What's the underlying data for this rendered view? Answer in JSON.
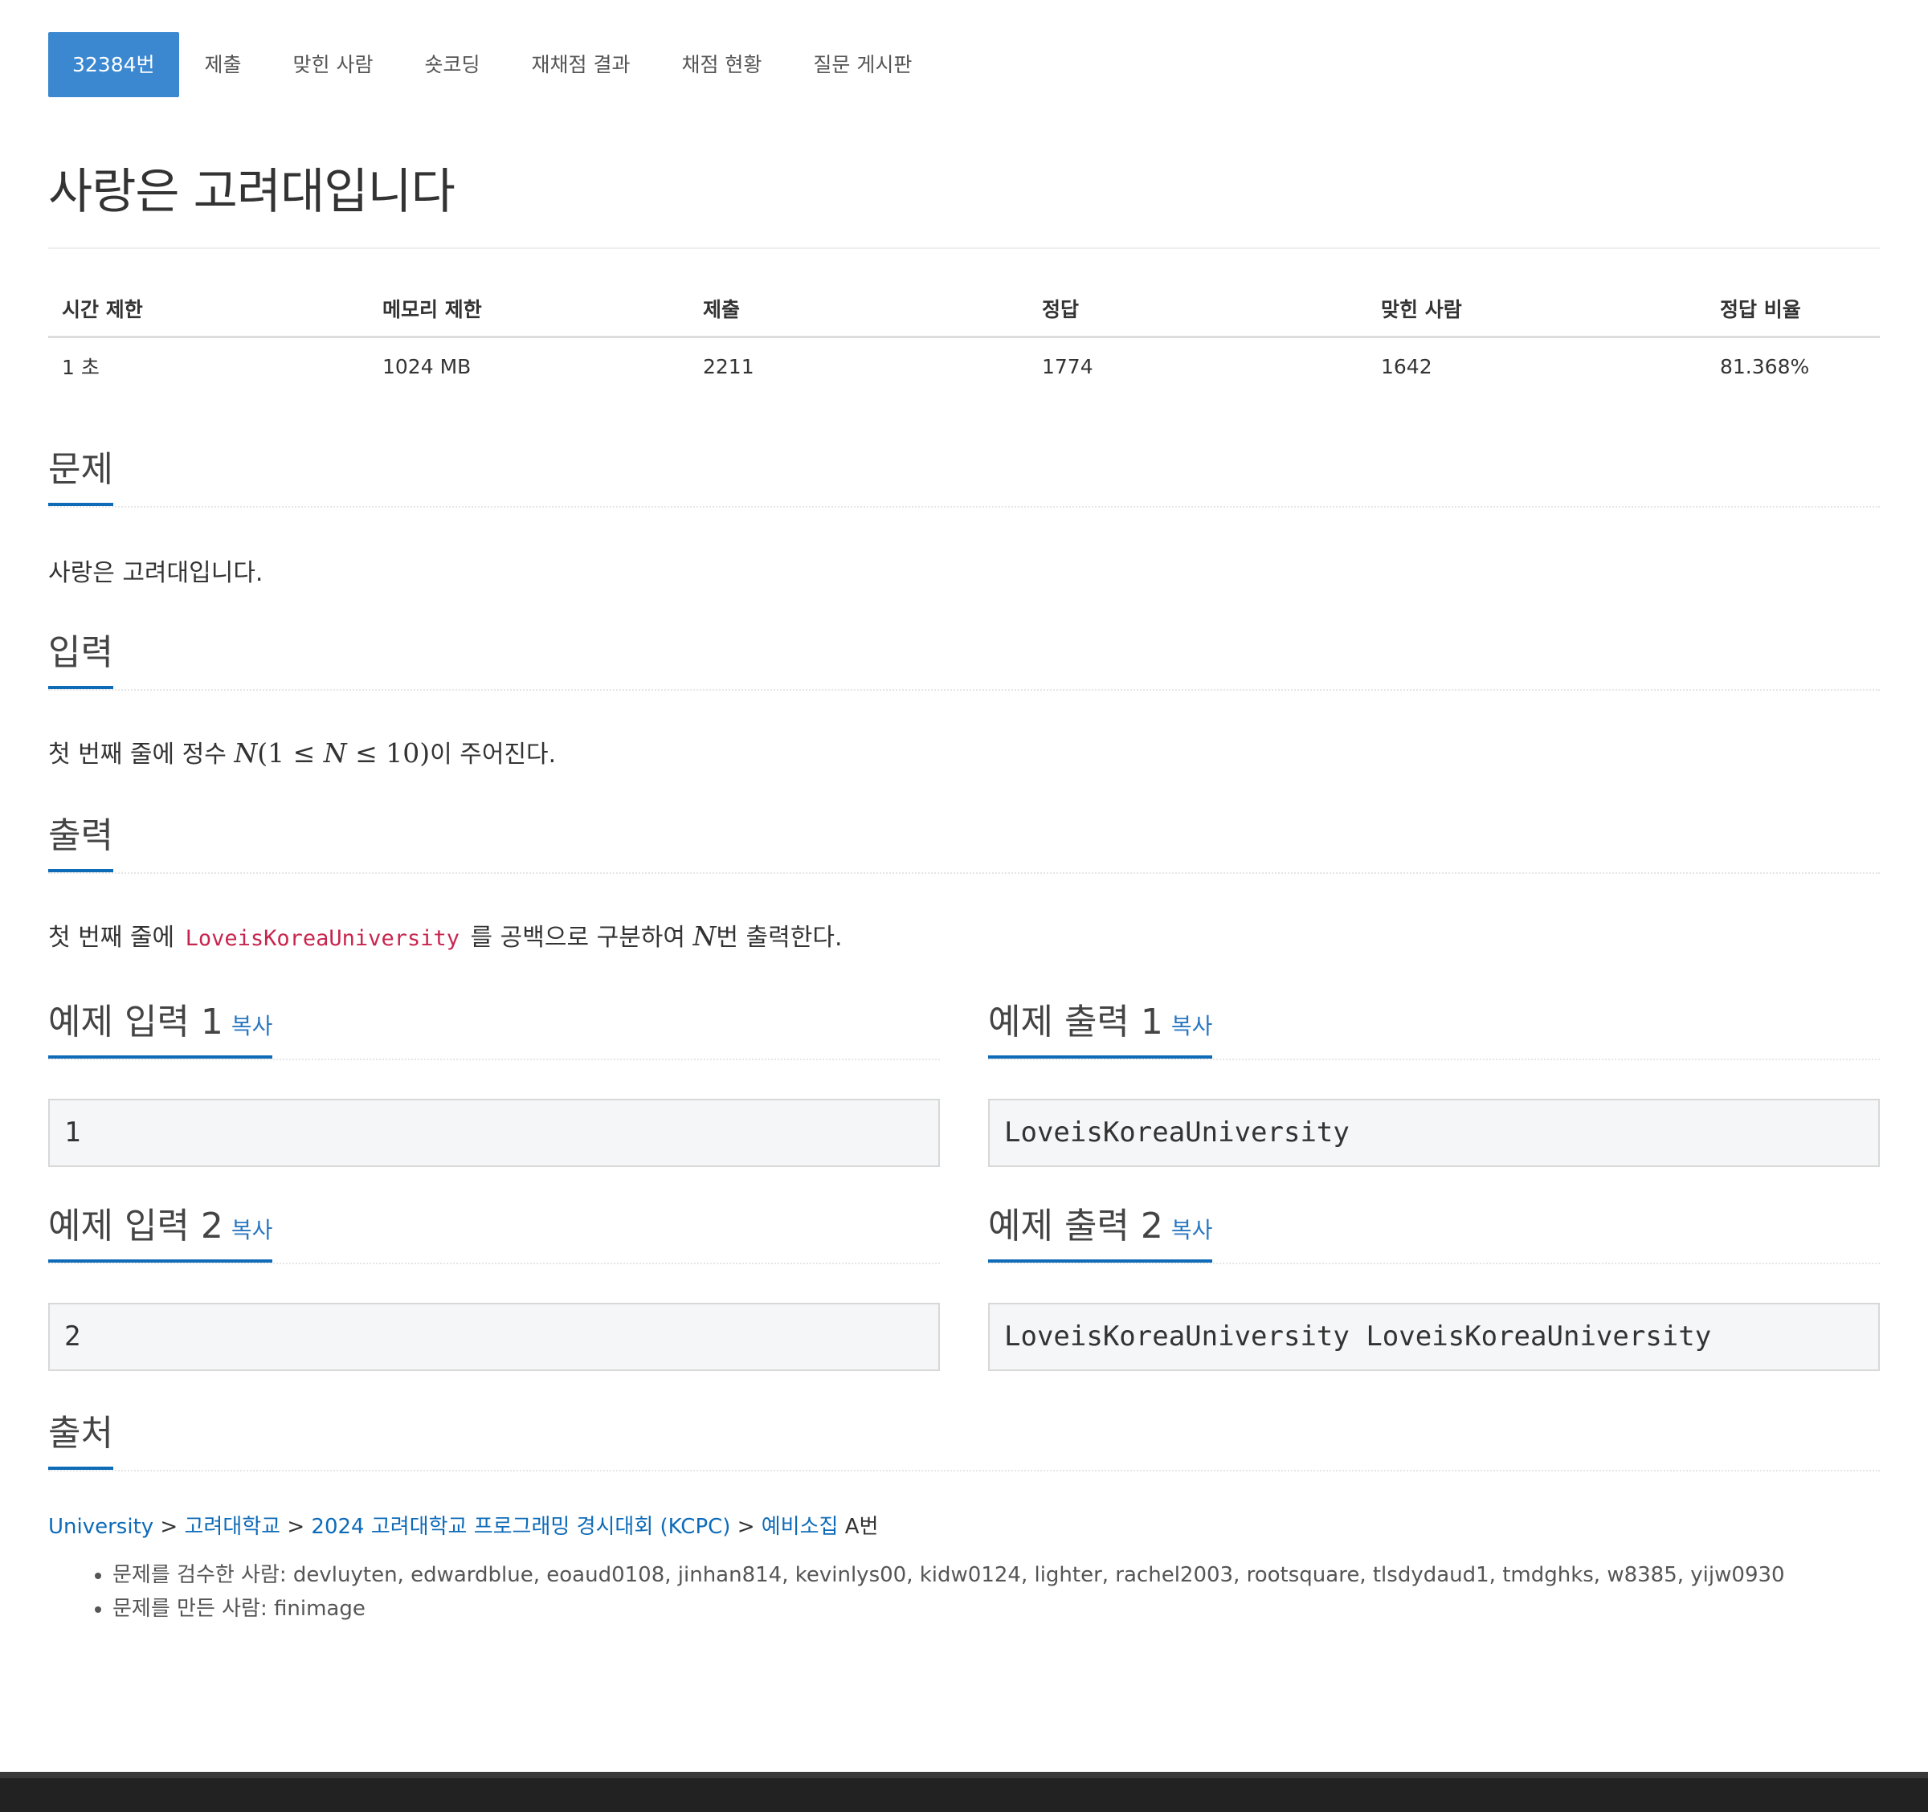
{
  "tabs": [
    {
      "label": "32384번",
      "active": true
    },
    {
      "label": "제출"
    },
    {
      "label": "맞힌 사람"
    },
    {
      "label": "숏코딩"
    },
    {
      "label": "재채점 결과"
    },
    {
      "label": "채점 현황"
    },
    {
      "label": "질문 게시판"
    }
  ],
  "problem": {
    "title": "사랑은 고려대입니다"
  },
  "info": {
    "headers": [
      "시간 제한",
      "메모리 제한",
      "제출",
      "정답",
      "맞힌 사람",
      "정답 비율"
    ],
    "values": [
      "1 초",
      "1024 MB",
      "2211",
      "1774",
      "1642",
      "81.368%"
    ]
  },
  "sections": {
    "problem_heading": "문제",
    "problem_text": "사랑은 고려대입니다.",
    "input_heading": "입력",
    "input_prefix": "첫 번째 줄에 정수 ",
    "input_math_n": "N",
    "input_math_open": "(1 ≤ ",
    "input_math_n2": "N",
    "input_math_close": " ≤ 10)",
    "input_suffix": "이 주어진다.",
    "output_heading": "출력",
    "output_prefix": "첫 번째 줄에 ",
    "output_code": "LoveisKoreaUniversity",
    "output_mid": " 를 공백으로 구분하여 ",
    "output_math_n": "N",
    "output_suffix": "번 출력한다.",
    "source_heading": "출처"
  },
  "samples": {
    "copy_label": "복사",
    "in1_heading": "예제 입력 1",
    "in1_value": "1",
    "out1_heading": "예제 출력 1",
    "out1_value": "LoveisKoreaUniversity",
    "in2_heading": "예제 입력 2",
    "in2_value": "2",
    "out2_heading": "예제 출력 2",
    "out2_value": "LoveisKoreaUniversity LoveisKoreaUniversity"
  },
  "source": {
    "link1": "University",
    "link2": "고려대학교",
    "link3": "2024 고려대학교 프로그래밍 경시대회 (KCPC)",
    "link4": "예비소집",
    "separator": " > ",
    "suffix": " A번",
    "reviewers": "문제를 검수한 사람: devluyten, edwardblue, eoaud0108, jinhan814, kevinlys00, kidw0124, lighter, rachel2003, rootsquare, tlsdydaud1, tmdghks, w8385, yijw0930",
    "author": "문제를 만든 사람: finimage"
  },
  "colors": {
    "accent": "#3b88d1",
    "link": "#0e6bb8",
    "code": "#c7254e"
  }
}
